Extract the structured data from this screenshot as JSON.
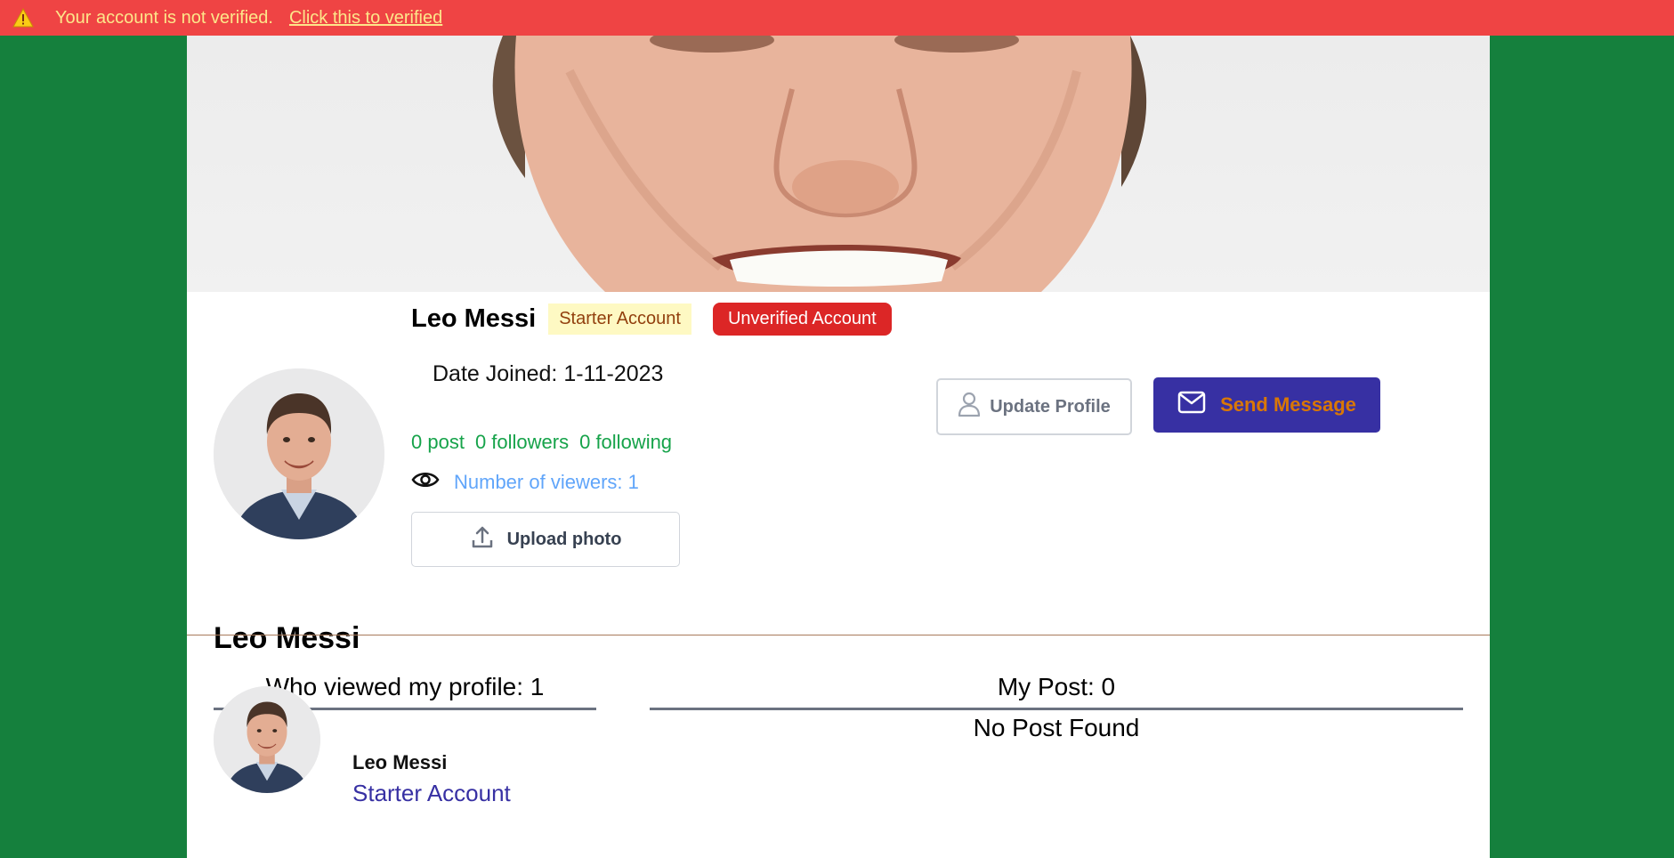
{
  "alert": {
    "message": "Your account is not verified.",
    "link_text": "Click this to verified",
    "color": "#ef4444",
    "text_color": "#fde68a"
  },
  "profile": {
    "name": "Leo Messi",
    "account_type": "Starter Account",
    "verification_status": "Unverified Account",
    "date_joined": "Date Joined: 1-11-2023",
    "stats": {
      "posts": "0 post",
      "followers": "0 followers",
      "following": "0 following"
    },
    "viewers": "Number of viewers: 1",
    "upload_label": "Upload photo",
    "update_label": "Update Profile",
    "message_label": "Send Message",
    "display_name": "Leo Messi"
  },
  "sections": {
    "who_viewed_title": "Who viewed my profile: 1",
    "my_post_title": "My Post: 0",
    "no_post_text": "No Post Found"
  },
  "viewers_list": [
    {
      "name": "Leo Messi",
      "account_type": "Starter Account"
    }
  ],
  "icons": {
    "alert": "warning-icon",
    "viewers": "eye-icon",
    "upload": "upload-icon",
    "update": "user-icon",
    "message": "envelope-icon"
  },
  "colors": {
    "page_background": "#15803d",
    "send_button": "#3730a3",
    "unverified_badge": "#dc2626",
    "starter_badge": "#fef9c3",
    "stats_text": "#16a34a",
    "viewers_text": "#60a5fa"
  }
}
